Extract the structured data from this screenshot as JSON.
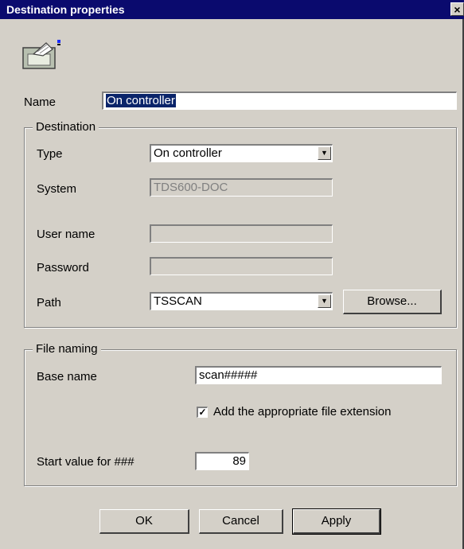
{
  "window": {
    "title": "Destination properties",
    "close_label": "×"
  },
  "name": {
    "label": "Name",
    "value": "On controller"
  },
  "destination": {
    "legend": "Destination",
    "type_label": "Type",
    "type_value": "On controller",
    "system_label": "System",
    "system_value": "TDS600-DOC",
    "username_label": "User name",
    "username_value": "",
    "password_label": "Password",
    "password_value": "",
    "path_label": "Path",
    "path_value": "TSSCAN",
    "browse_label": "Browse..."
  },
  "file_naming": {
    "legend": "File naming",
    "base_label": "Base name",
    "base_value": "scan#####",
    "extension_checked": true,
    "extension_label": "Add the appropriate file extension",
    "start_label": "Start value for ###",
    "start_value": "89"
  },
  "buttons": {
    "ok": "OK",
    "cancel": "Cancel",
    "apply": "Apply"
  },
  "icons": {
    "dialog": "document-tray-icon",
    "dropdown": "chevron-down-icon",
    "check": "checkmark-icon"
  }
}
